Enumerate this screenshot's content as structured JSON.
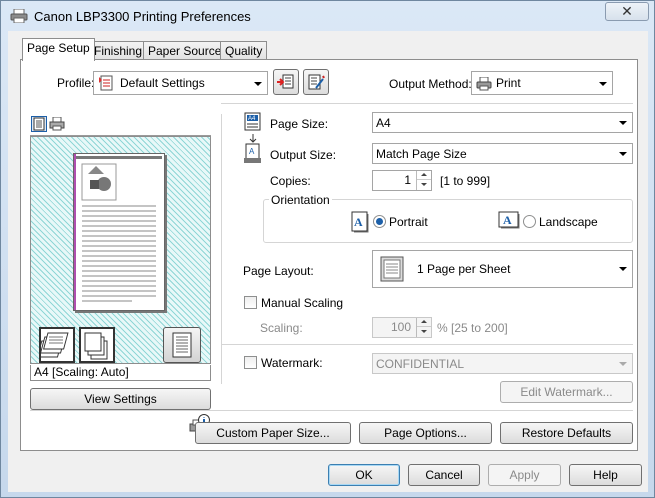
{
  "window": {
    "title": "Canon LBP3300 Printing Preferences",
    "close_glyph": "✕"
  },
  "tabs": [
    {
      "label": "Page Setup",
      "active": true
    },
    {
      "label": "Finishing",
      "active": false
    },
    {
      "label": "Paper Source",
      "active": false
    },
    {
      "label": "Quality",
      "active": false
    }
  ],
  "profile": {
    "label": "Profile:",
    "value": "Default Settings"
  },
  "output_method": {
    "label": "Output Method:",
    "value": "Print"
  },
  "page_size": {
    "label": "Page Size:",
    "value": "A4"
  },
  "output_size": {
    "label": "Output Size:",
    "value": "Match Page Size"
  },
  "copies": {
    "label": "Copies:",
    "value": "1",
    "range": "[1 to 999]"
  },
  "orientation": {
    "label": "Orientation",
    "portrait_label": "Portrait",
    "landscape_label": "Landscape",
    "selected": "Portrait",
    "icon_letter": "A"
  },
  "page_layout": {
    "label": "Page Layout:",
    "value": "1 Page per Sheet"
  },
  "manual_scaling": {
    "label": "Manual Scaling",
    "checked": false
  },
  "scaling": {
    "label": "Scaling:",
    "value": "100",
    "range": "% [25 to 200]"
  },
  "watermark": {
    "label": "Watermark:",
    "checked": false,
    "value": "CONFIDENTIAL",
    "edit_label": "Edit Watermark..."
  },
  "preview": {
    "status": "A4 [Scaling: Auto]",
    "view_settings_label": "View Settings"
  },
  "buttons": {
    "custom_paper_size": "Custom Paper Size...",
    "page_options": "Page Options...",
    "restore_defaults": "Restore Defaults",
    "ok": "OK",
    "cancel": "Cancel",
    "apply": "Apply",
    "help": "Help"
  },
  "icons": {
    "title": "printer-icon",
    "profile": "profile-icon",
    "add_profile": "add-profile-icon",
    "edit_profile": "edit-profile-icon",
    "output_method": "printer-icon",
    "page_size": "page-size-icon",
    "output_size": "output-size-icon",
    "preview_mode_page": "preview-page-icon",
    "preview_mode_printer": "preview-printer-icon",
    "page_layout": "page-layout-icon",
    "info": "printer-info-icon"
  },
  "colors": {
    "accent": "#1c5fa8",
    "preview_hatch": "#8fd6d6",
    "margin_line": "#b04fb0"
  }
}
